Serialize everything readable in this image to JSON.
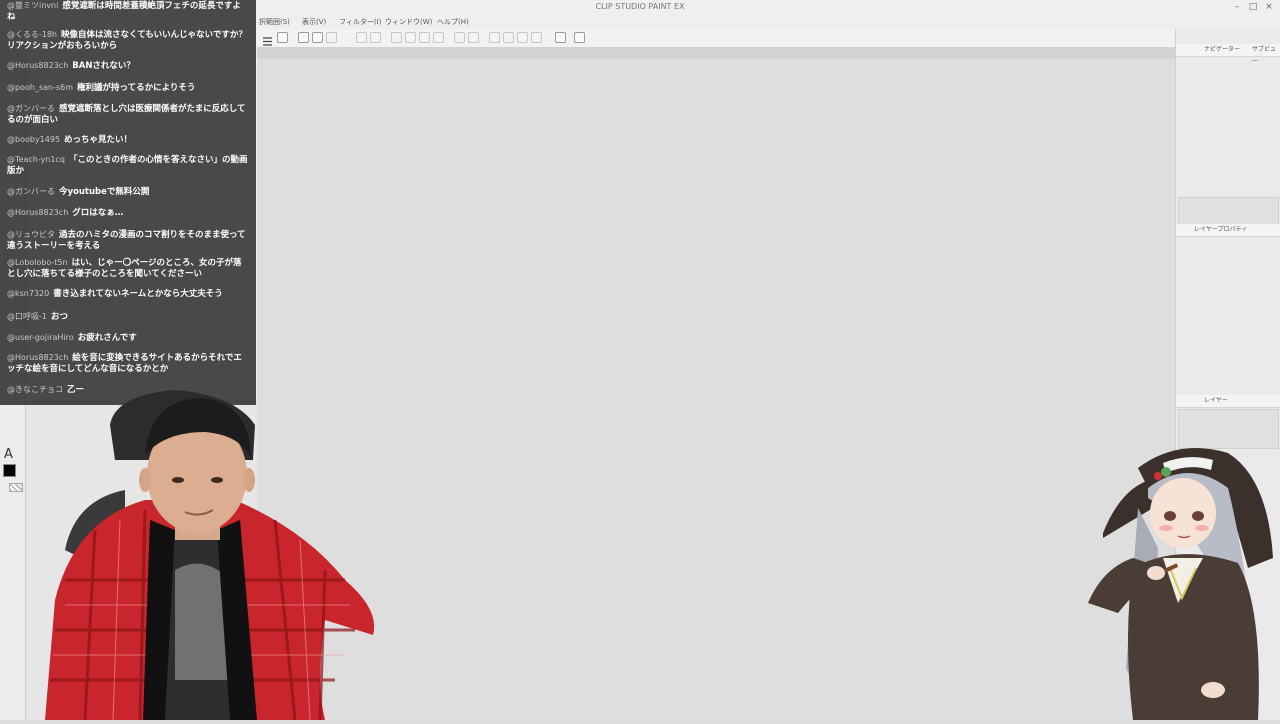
{
  "app": {
    "title": "CLIP STUDIO PAINT EX"
  },
  "menu": [
    "択範囲(S)",
    "表示(V)",
    "フィルター(I)",
    "ウィンドウ(W)",
    "ヘルプ(H)"
  ],
  "window_controls": {
    "minimize": "–",
    "maximize": "□",
    "close": "×"
  },
  "right_panel": {
    "navigator_tab": "ナビゲーター",
    "subview_tab": "サブビュー",
    "layer_property_tab": "レイヤープロパティ",
    "layer_tab": "レイヤー"
  },
  "tools": {
    "text_tool_glyph": "A"
  },
  "colors": {
    "main_color": "#000000",
    "chat_background": "#282828",
    "canvas": "#dedede"
  },
  "chat": [
    {
      "author": "@篁ミツinvni",
      "text": "感覚遮断は時間差蓋積絶頂フェチの延長ですよね"
    },
    {
      "author": "@くるる-18h",
      "text": "映像自体は流さなくてもいいんじゃないですか？リアクションがおもろいから"
    },
    {
      "author": "@Horus8823ch",
      "text": "BANされない？"
    },
    {
      "author": "@pooh_san-s6m",
      "text": "権利議が持ってるかによりそう"
    },
    {
      "author": "@ガンバーる",
      "text": "感覚遮断落とし穴は医療関係者がたまに反応してるのが面白い"
    },
    {
      "author": "@booby1495",
      "text": "めっちゃ見たい！"
    },
    {
      "author": "@Teach-yn1cq",
      "text": "「このときの作者の心情を答えなさい」の動画版か"
    },
    {
      "author": "@ガンバーる",
      "text": "今youtubeで無料公開"
    },
    {
      "author": "@Horus8823ch",
      "text": "グロはなぁ…"
    },
    {
      "author": "@リュウビタ",
      "text": "過去のハミタの漫画のコマ割りをそのまま使って違うストーリーを考える"
    },
    {
      "author": "@Lobolobo-t5n",
      "text": "はい、じゃー〇ページのところ、女の子が落とし穴に落ちてる様子のところを聞いてくださーい"
    },
    {
      "author": "@ksn7320",
      "text": "書き込まれてないネームとかなら大丈夫そう"
    },
    {
      "author": "@口呼吸-1",
      "text": "おつ"
    },
    {
      "author": "@user-gojiraHiro",
      "text": "お疲れさんです"
    },
    {
      "author": "@Horus8823ch",
      "text": "絵を音に変換できるサイトあるからそれでエッチな絵を音にしてどんな音になるかとか"
    },
    {
      "author": "@きなこチョコ",
      "text": "乙ー"
    }
  ]
}
